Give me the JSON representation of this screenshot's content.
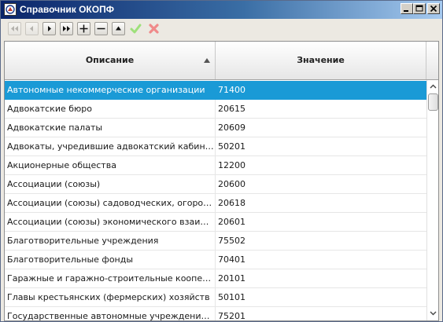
{
  "window": {
    "title": "Справочник ОКОПФ",
    "icon": "app-icon",
    "controls": [
      "minimize-icon",
      "maximize-icon",
      "close-icon"
    ]
  },
  "toolbar": {
    "buttons": [
      {
        "name": "first-record-button",
        "icon": "first-icon",
        "enabled": false
      },
      {
        "name": "prior-record-button",
        "icon": "prior-icon",
        "enabled": false
      },
      {
        "name": "next-record-button",
        "icon": "next-icon",
        "enabled": true
      },
      {
        "name": "last-record-button",
        "icon": "last-icon",
        "enabled": true
      },
      {
        "name": "insert-record-button",
        "icon": "plus-icon",
        "enabled": true
      },
      {
        "name": "delete-record-button",
        "icon": "minus-icon",
        "enabled": true
      },
      {
        "name": "edit-record-button",
        "icon": "up-triangle-icon",
        "enabled": true
      },
      {
        "name": "post-record-button",
        "icon": "checkmark-icon",
        "enabled": false
      },
      {
        "name": "cancel-record-button",
        "icon": "cancel-x-icon",
        "enabled": false
      }
    ]
  },
  "grid": {
    "columns": [
      "Описание",
      "Значение"
    ],
    "sort": {
      "column": "Описание",
      "direction": "ascending"
    },
    "selected_row": 0,
    "rows": [
      {
        "description": "Автономные некоммерческие организации",
        "value": "71400"
      },
      {
        "description": "Адвокатские бюро",
        "value": "20615"
      },
      {
        "description": "Адвокатские палаты",
        "value": "20609"
      },
      {
        "description": "Адвокаты, учредившие адвокатский кабинет",
        "value": "50201"
      },
      {
        "description": "Акционерные общества",
        "value": "12200"
      },
      {
        "description": "Ассоциации (союзы)",
        "value": "20600"
      },
      {
        "description": "Ассоциации (союзы) садоводческих, огороднических",
        "value": "20618"
      },
      {
        "description": "Ассоциации (союзы) экономического взаимодействия",
        "value": "20601"
      },
      {
        "description": "Благотворительные учреждения",
        "value": "75502"
      },
      {
        "description": "Благотворительные фонды",
        "value": "70401"
      },
      {
        "description": "Гаражные и гаражно-строительные кооперативы",
        "value": "20101"
      },
      {
        "description": "Главы крестьянских (фермерских) хозяйств",
        "value": "50101"
      },
      {
        "description": "Государственные автономные учреждения субъектов",
        "value": "75201"
      }
    ]
  },
  "colors": {
    "selection": "#1a9ad6",
    "titlebar_start": "#0a246a",
    "titlebar_end": "#a6caf0"
  }
}
